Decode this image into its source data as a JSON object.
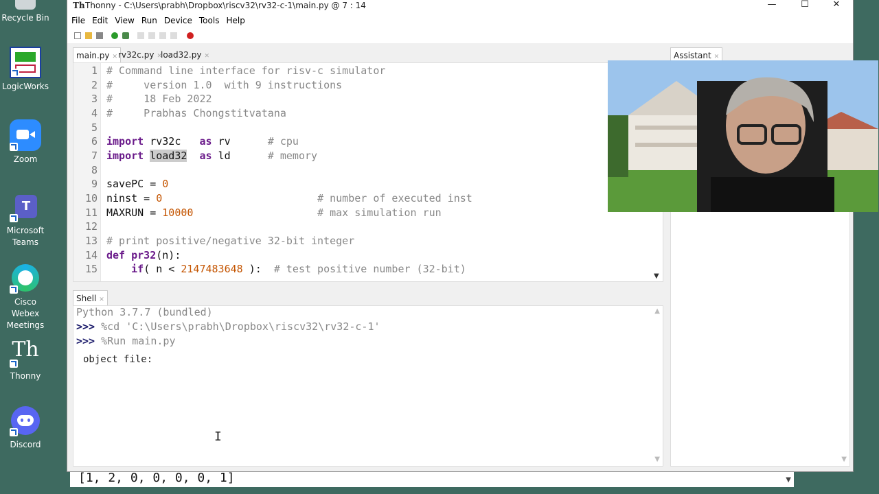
{
  "desktop": {
    "icons": [
      {
        "label": "Recycle Bin",
        "icon": "recycle-bin-icon"
      },
      {
        "label": "LogicWorks",
        "icon": "logicworks-icon"
      },
      {
        "label": "Zoom",
        "icon": "zoom-icon"
      },
      {
        "label": "Microsoft Teams",
        "icon": "teams-icon"
      },
      {
        "label": "Cisco Webex Meetings",
        "icon": "webex-icon"
      },
      {
        "label": "Thonny",
        "icon": "thonny-icon"
      },
      {
        "label": "Discord",
        "icon": "discord-icon"
      }
    ]
  },
  "window": {
    "title": "Thonny  -  C:\\Users\\prabh\\Dropbox\\riscv32\\rv32-c-1\\main.py  @  7 : 14",
    "minimize": "—",
    "maximize": "☐",
    "close": "✕"
  },
  "menu": [
    "File",
    "Edit",
    "View",
    "Run",
    "Device",
    "Tools",
    "Help"
  ],
  "editor": {
    "tabs": [
      {
        "label": "main.py",
        "active": true
      },
      {
        "label": "rv32c.py",
        "active": false
      },
      {
        "label": "load32.py",
        "active": false
      }
    ],
    "line_numbers": [
      "1",
      "2",
      "3",
      "4",
      "5",
      "6",
      "7",
      "8",
      "9",
      "10",
      "11",
      "12",
      "13",
      "14",
      "15"
    ],
    "lines": [
      {
        "comment": "# Command line interface for risv-c simulator"
      },
      {
        "comment": "#     version 1.0  with 9 instructions"
      },
      {
        "comment": "#     18 Feb 2022"
      },
      {
        "comment": "#     Prabhas Chongstitvatana"
      },
      {},
      {
        "kw": "import",
        "mod": "rv32c",
        "as": "as",
        "alias": "rv",
        "comment": "# cpu"
      },
      {
        "kw": "import",
        "mod": "load32",
        "as": "as",
        "alias": "ld",
        "comment": "# memory"
      },
      {},
      {
        "var": "savePC = ",
        "num": "0"
      },
      {
        "var": "ninst = ",
        "num": "0",
        "comment": "# number of executed inst"
      },
      {
        "var": "MAXRUN = ",
        "num": "10000",
        "comment": "# max simulation run"
      },
      {},
      {
        "comment": "# print positive/negative 32-bit integer"
      },
      {
        "kw": "def",
        "fn": "pr32",
        "rest": "(n):"
      },
      {
        "kw": "if",
        "pre": "( n < ",
        "num": "2147483648",
        "post": " ):",
        "comment": "# test positive number (32-bit)"
      }
    ]
  },
  "shell": {
    "tab": "Shell",
    "banner": "Python 3.7.7 (bundled)",
    "prompt": ">>>",
    "cmd1": " %cd 'C:\\Users\\prabh\\Dropbox\\riscv32\\rv32-c-1'",
    "cmd2": " %Run main.py",
    "output": "object file: "
  },
  "assistant": {
    "tab": "Assistant"
  },
  "bottom": {
    "text": "[1, 2, 0, 0, 0, 0, 1]"
  }
}
